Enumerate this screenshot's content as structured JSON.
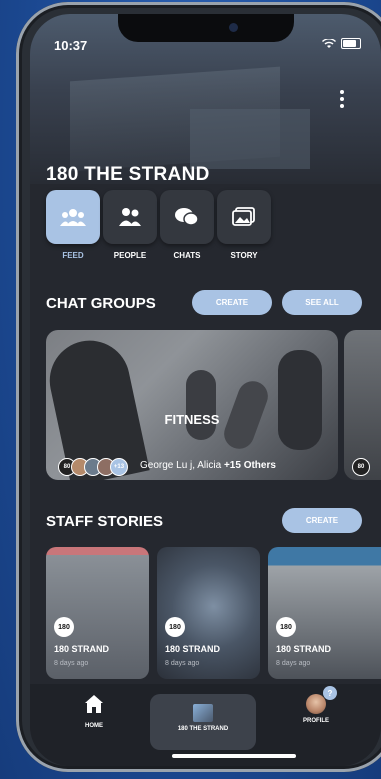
{
  "status": {
    "time": "10:37"
  },
  "header": {
    "title": "180 THE STRAND"
  },
  "tabs": [
    {
      "label": "FEED",
      "icon": "group-icon"
    },
    {
      "label": "PEOPLE",
      "icon": "people-icon"
    },
    {
      "label": "CHATS",
      "icon": "chat-bubbles-icon"
    },
    {
      "label": "STORY",
      "icon": "photo-stack-icon"
    }
  ],
  "chat_groups": {
    "title": "CHAT GROUPS",
    "create_label": "CREATE",
    "see_all_label": "SEE ALL",
    "card": {
      "name": "FITNESS",
      "members_text": "George Lu j, Alicia",
      "others_text": "+15 Others",
      "more_badge": "+13"
    }
  },
  "staff_stories": {
    "title": "STAFF STORIES",
    "create_label": "CREATE",
    "items": [
      {
        "title": "180 STRAND",
        "date": "8 days ago",
        "logo": "180"
      },
      {
        "title": "180 STRAND",
        "date": "8 days ago",
        "logo": "180"
      },
      {
        "title": "180 STRAND",
        "date": "8 days ago",
        "logo": "180"
      }
    ]
  },
  "bottom_nav": {
    "home": "HOME",
    "strand": "180 THE STRAND",
    "profile": "PROFILE",
    "profile_badge": "?"
  },
  "colors": {
    "accent": "#a9c3e4",
    "background": "#25282f"
  }
}
